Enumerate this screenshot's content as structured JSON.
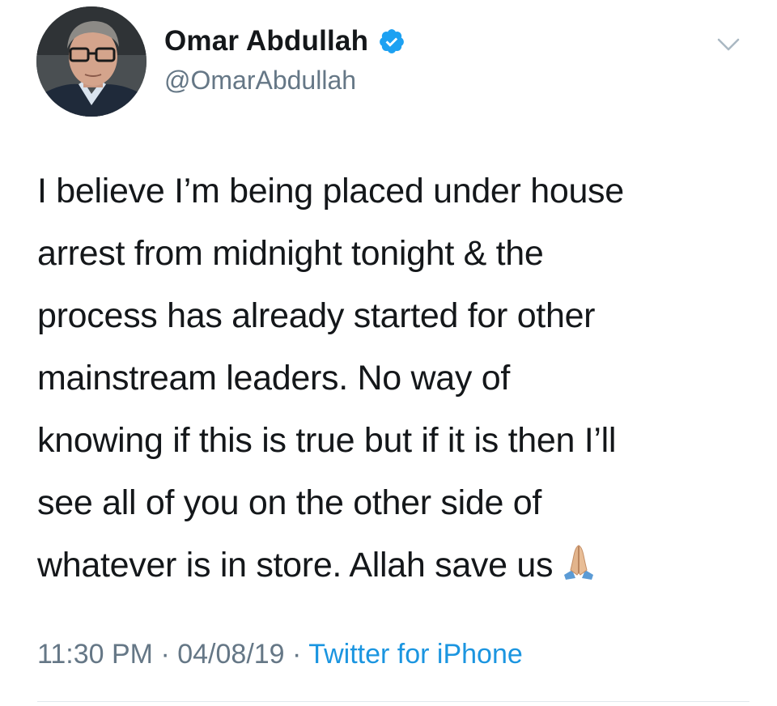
{
  "author": {
    "name": "Omar Abdullah",
    "handle": "@OmarAbdullah",
    "verified_icon": "verified-badge-icon",
    "avatar_icon": "profile-photo"
  },
  "menu_icon": "chevron-down-icon",
  "tweet": {
    "lines": [
      "I believe I’m being placed under house",
      "arrest from midnight tonight & the",
      "process has already started for other",
      "mainstream leaders. No way of",
      "knowing if this is true but if it is then I’ll",
      "see all of you on the other side of",
      "whatever is in store. Allah save us"
    ],
    "emoji_icon": "folded-hands-icon"
  },
  "meta": {
    "time": "11:30 PM",
    "date": "04/08/19",
    "source": "Twitter for iPhone",
    "separator": " · "
  },
  "colors": {
    "text": "#14171a",
    "secondary": "#657786",
    "link": "#1b95e0",
    "verified": "#1da1f2",
    "divider": "#e1e8ed"
  }
}
